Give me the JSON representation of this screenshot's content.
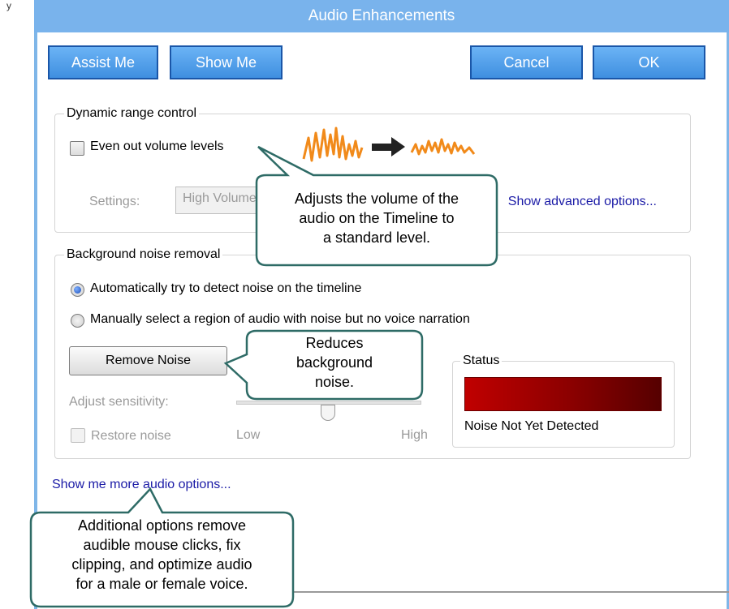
{
  "dialog": {
    "title": "Audio Enhancements",
    "buttons": {
      "assist": "Assist Me",
      "show": "Show Me",
      "cancel": "Cancel",
      "ok": "OK"
    }
  },
  "edge_text": "y",
  "dynamic_range": {
    "legend": "Dynamic range control",
    "checkbox_label": "Even out volume levels",
    "settings_label": "Settings:",
    "settings_value": "High Volume",
    "advanced_link": "Show advanced options..."
  },
  "noise": {
    "legend": "Background noise removal",
    "radio_auto": "Automatically try to detect noise on the timeline",
    "radio_manual": "Manually select a region of audio with noise but no voice narration",
    "remove_button": "Remove Noise",
    "sensitivity_label": "Adjust sensitivity:",
    "slider_low": "Low",
    "slider_high": "High",
    "restore_label": "Restore noise",
    "status_legend": "Status",
    "status_text": "Noise Not Yet Detected",
    "status_color": "#a00000"
  },
  "more_link": "Show me more audio options...",
  "callouts": {
    "volume": [
      "Adjusts the volume of the",
      "audio on the Timeline to",
      "a standard level."
    ],
    "noise": [
      "Reduces",
      "background",
      "noise."
    ],
    "more": [
      "Additional options remove",
      "audible mouse clicks, fix",
      "clipping, and optimize audio",
      "for a male or female voice."
    ]
  },
  "colors": {
    "accent": "#79b3ec",
    "callout_border": "#2e6b66",
    "link": "#1a1aa6"
  }
}
